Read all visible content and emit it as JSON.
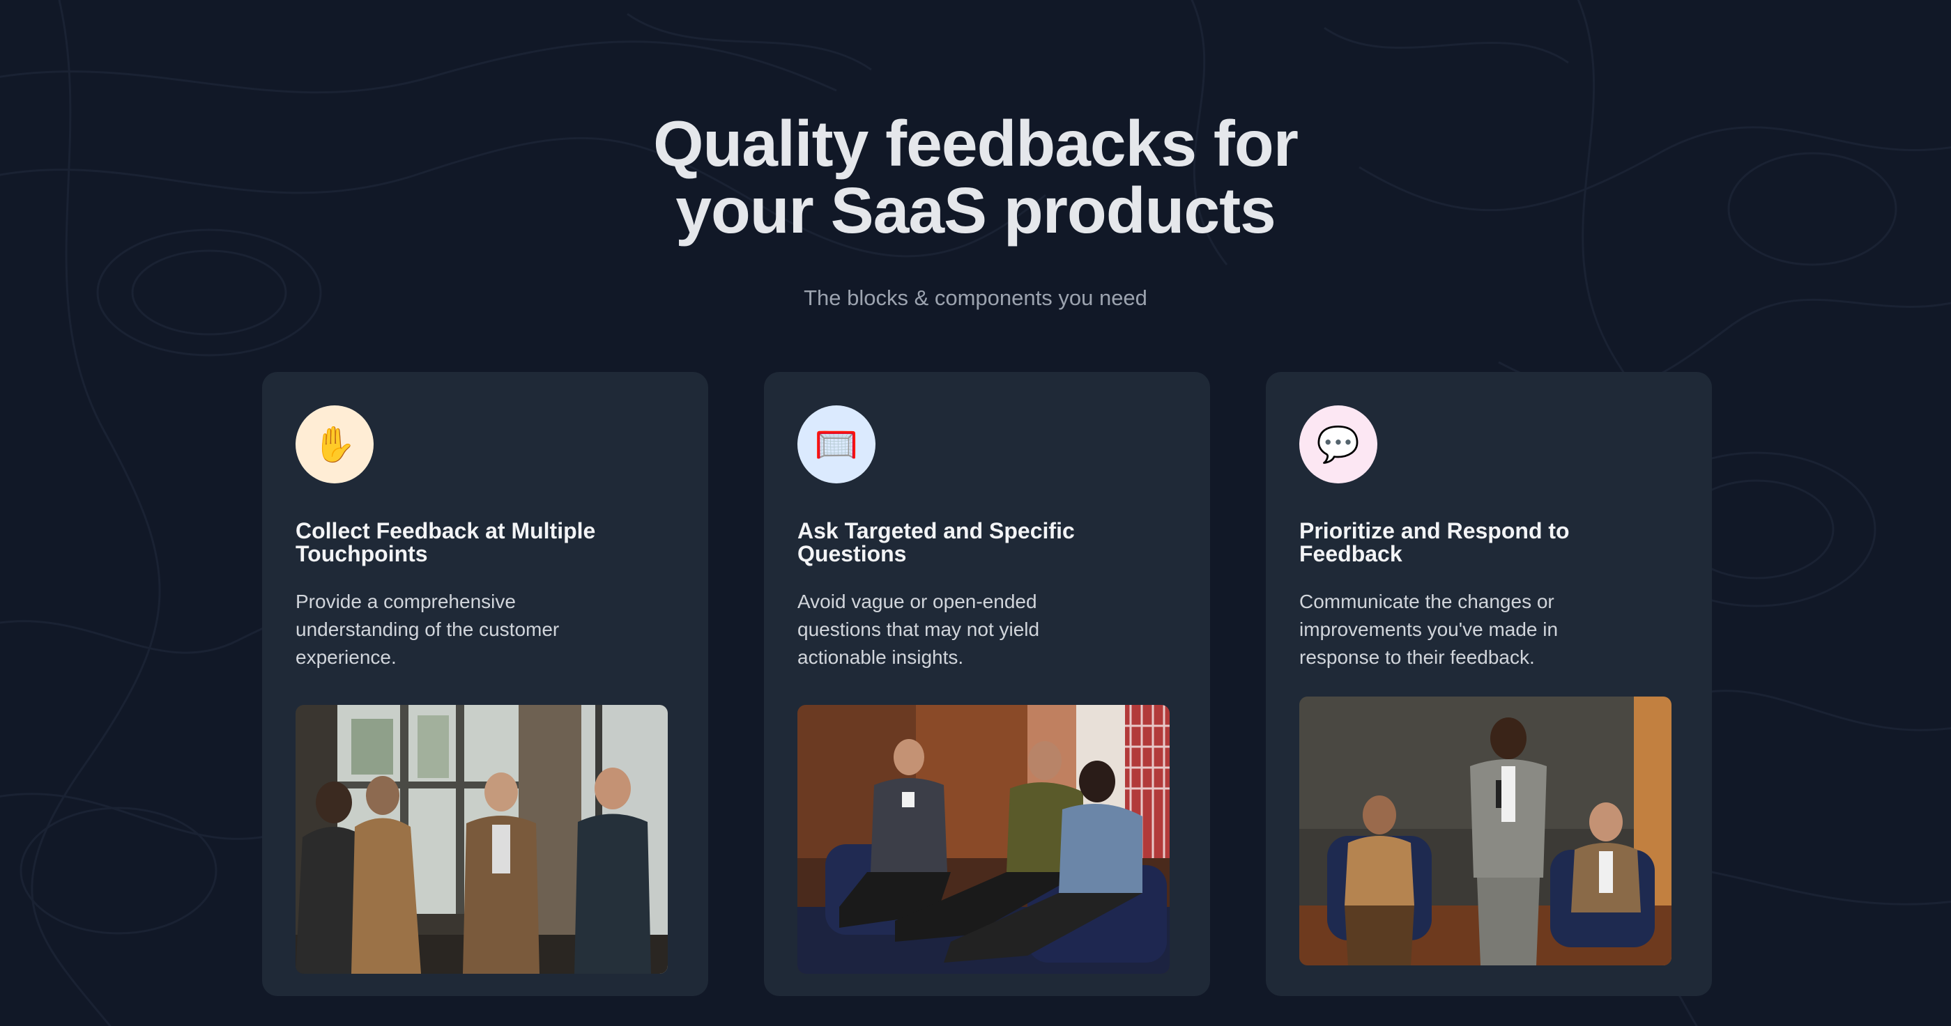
{
  "hero": {
    "title_line1": "Quality feedbacks for",
    "title_line2": "your SaaS products",
    "subtitle": "The blocks & components you need"
  },
  "features": [
    {
      "icon": "raised-hand-icon",
      "icon_glyph": "✋",
      "icon_bg": "#ffedd5",
      "title": "Collect Feedback at Multiple Touchpoints",
      "description": "Provide a comprehensive understanding of the customer experience.",
      "image_alt": "Four men in suits talking by a large window"
    },
    {
      "icon": "goal-net-icon",
      "icon_glyph": "🥅",
      "icon_bg": "#dbeafe",
      "title": "Ask Targeted and Specific Questions",
      "description": "Avoid vague or open-ended questions that may not yield actionable insights.",
      "image_alt": "Panel of people seated in armchairs during a discussion"
    },
    {
      "icon": "speech-bubble-icon",
      "icon_glyph": "💬",
      "icon_bg": "#fce7f3",
      "title": "Prioritize and Respond to Feedback",
      "description": "Communicate the changes or improvements you've made in response to their feedback.",
      "image_alt": "Speaker with microphone standing between two seated panelists"
    }
  ],
  "colors": {
    "background": "#111827",
    "card": "#1f2937",
    "heading": "#e5e7eb",
    "muted": "#9ca3af"
  }
}
